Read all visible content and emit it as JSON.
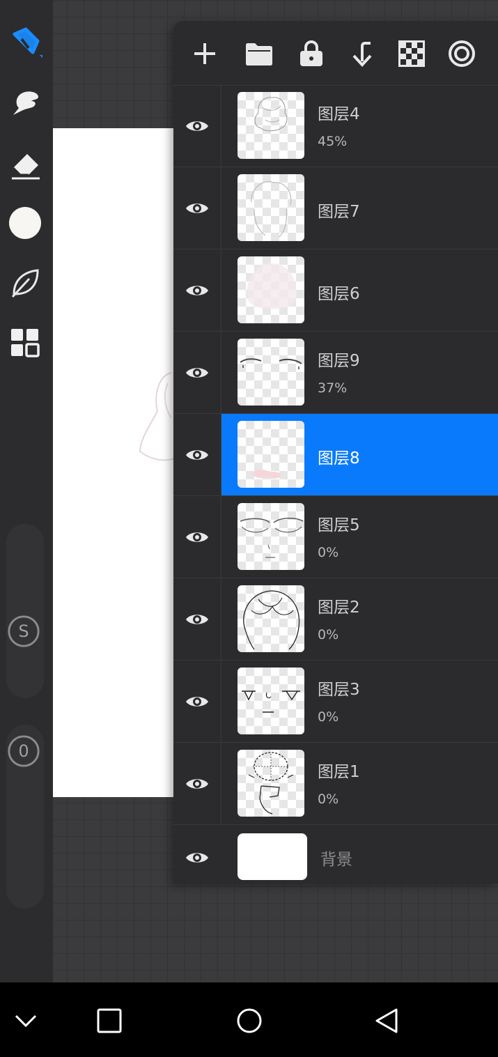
{
  "toolbar": {
    "tools": [
      {
        "name": "brush-tool",
        "icon": "pen-nib-icon",
        "active": true
      },
      {
        "name": "smudge-tool",
        "icon": "smudge-icon"
      },
      {
        "name": "eraser-tool",
        "icon": "eraser-icon"
      },
      {
        "name": "color-picker",
        "icon": "color-circle",
        "color": "#f8f6f2"
      },
      {
        "name": "leaf-tool",
        "icon": "leaf-icon"
      },
      {
        "name": "layers-tool",
        "icon": "grid-icon"
      }
    ],
    "size_label": "S",
    "opacity_label": "0",
    "accent": "#1a8cff"
  },
  "layer_panel": {
    "actions": [
      {
        "name": "add-layer",
        "icon": "plus-icon"
      },
      {
        "name": "group-layer",
        "icon": "folder-icon"
      },
      {
        "name": "lock-layer",
        "icon": "lock-icon"
      },
      {
        "name": "merge-down",
        "icon": "merge-down-icon"
      },
      {
        "name": "transparency",
        "icon": "checker-icon"
      },
      {
        "name": "reference",
        "icon": "target-icon"
      }
    ],
    "layers": [
      {
        "name": "图层4",
        "opacity": "45%"
      },
      {
        "name": "图层7",
        "opacity": ""
      },
      {
        "name": "图层6",
        "opacity": ""
      },
      {
        "name": "图层9",
        "opacity": "37%"
      },
      {
        "name": "图层8",
        "opacity": "",
        "selected": true
      },
      {
        "name": "图层5",
        "opacity": "0%"
      },
      {
        "name": "图层2",
        "opacity": "0%"
      },
      {
        "name": "图层3",
        "opacity": "0%"
      },
      {
        "name": "图层1",
        "opacity": "0%"
      }
    ],
    "background": {
      "name": "背景"
    },
    "selected_color": "#0a7afc"
  },
  "navbar": {
    "buttons": [
      {
        "name": "collapse",
        "icon": "chevron-down-icon"
      },
      {
        "name": "recents",
        "icon": "square-icon"
      },
      {
        "name": "home",
        "icon": "circle-icon"
      },
      {
        "name": "back",
        "icon": "triangle-back-icon"
      }
    ]
  }
}
